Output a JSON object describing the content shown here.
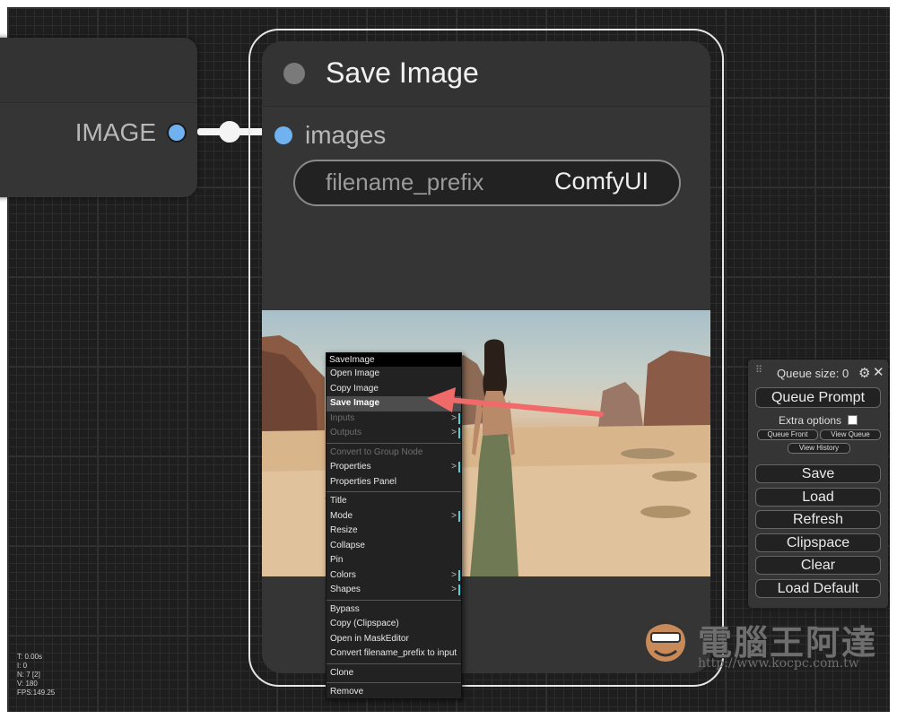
{
  "left_node": {
    "output_label": "IMAGE"
  },
  "save_node": {
    "title": "Save Image",
    "input_label": "images",
    "widget": {
      "name": "filename_prefix",
      "value": "ComfyUI"
    }
  },
  "context_menu": {
    "title": "SaveImage",
    "groups": [
      [
        {
          "label": "Open Image"
        },
        {
          "label": "Copy Image"
        },
        {
          "label": "Save Image",
          "highlighted": true
        },
        {
          "label": "Inputs",
          "disabled": true,
          "submenu": ">"
        },
        {
          "label": "Outputs",
          "disabled": true,
          "submenu": ">"
        }
      ],
      [
        {
          "label": "Convert to Group Node",
          "disabled": true
        },
        {
          "label": "Properties",
          "submenu": ">"
        },
        {
          "label": "Properties Panel"
        }
      ],
      [
        {
          "label": "Title"
        },
        {
          "label": "Mode",
          "submenu": ">"
        },
        {
          "label": "Resize"
        },
        {
          "label": "Collapse"
        },
        {
          "label": "Pin"
        },
        {
          "label": "Colors",
          "submenu": ">"
        },
        {
          "label": "Shapes",
          "submenu": ">"
        }
      ],
      [
        {
          "label": "Bypass"
        },
        {
          "label": "Copy (Clipspace)"
        },
        {
          "label": "Open in MaskEditor"
        },
        {
          "label": "Convert filename_prefix to input"
        }
      ],
      [
        {
          "label": "Clone"
        }
      ],
      [
        {
          "label": "Remove"
        }
      ]
    ]
  },
  "queue_panel": {
    "queue_size": "Queue size: 0",
    "queue_prompt": "Queue Prompt",
    "extra_options": "Extra options",
    "queue_front": "Queue Front",
    "view_queue": "View Queue",
    "view_history": "View History",
    "buttons": [
      "Save",
      "Load",
      "Refresh",
      "Clipspace",
      "Clear",
      "Load Default"
    ]
  },
  "stats": [
    "T: 0.00s",
    "I: 0",
    "N: 7 [2]",
    "V: 180",
    "FPS:149.25"
  ],
  "watermark": {
    "text": "電腦王阿達",
    "url": "http://www.kocpc.com.tw"
  },
  "colors": {
    "slot_blue": "#70b2f0",
    "arrow_red": "#f06a6a",
    "canvas_bg": "#1e1e1e"
  }
}
